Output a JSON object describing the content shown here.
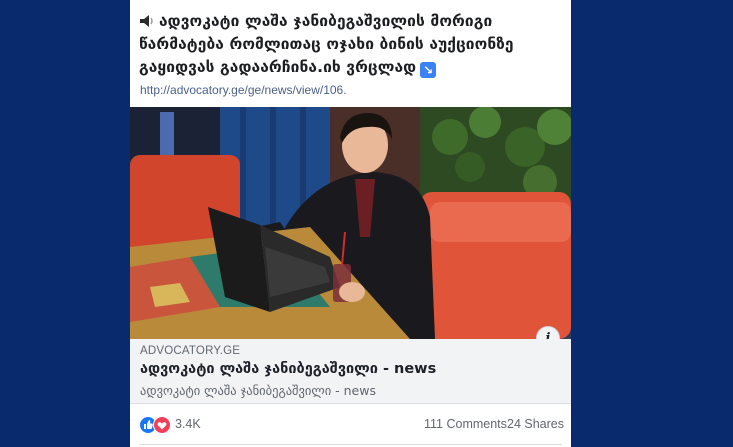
{
  "post": {
    "text": "ადვოკატი ლაშა ჯანიბეგაშვილის მორიგი წარმატება რომლითაც ოჯახი ბინის აუქციონზე გაყიდვას გადაარჩინა.იხ ვრცლად",
    "link_text": "http://advocatory.ge/ge/news/view/106."
  },
  "link_preview": {
    "domain": "ADVOCATORY.GE",
    "title": "ადვოკატი ლაშა ჯანიბეგაშვილი - news",
    "description": "ადვოკატი ლაშა ჯანიბეგაშვილი - news"
  },
  "stats": {
    "reactions_count": "3.4K",
    "comments": "111 Comments",
    "shares": "24 Shares"
  },
  "colors": {
    "page_background": "#0a2a6e",
    "link_preview_bg": "#f2f3f5",
    "like_blue": "#1877f2",
    "love_red": "#f33e58"
  },
  "icons": {
    "speaker": "speaker-icon",
    "arrow": "arrow-down-right-icon",
    "info": "info-icon",
    "like": "like-reaction-icon",
    "love": "love-reaction-icon"
  }
}
